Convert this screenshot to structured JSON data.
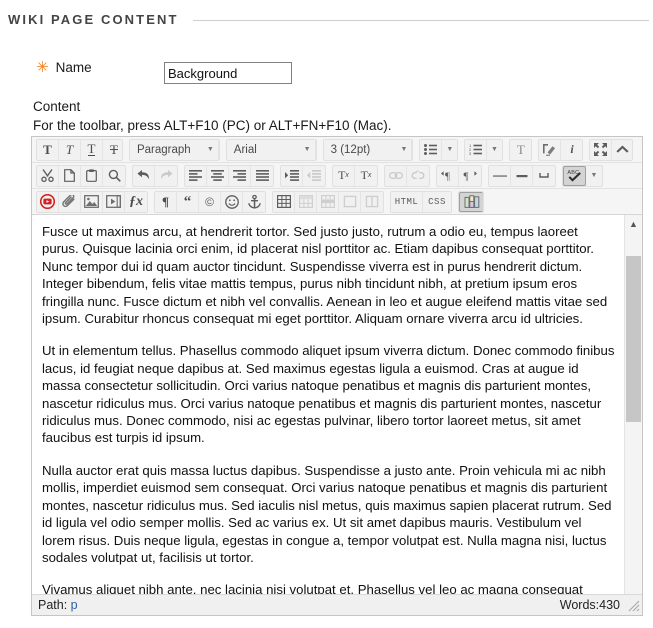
{
  "section": {
    "title": "Wiki Page Content"
  },
  "form": {
    "required_marker": "✳",
    "name_label": "Name",
    "name_value": "Background",
    "name_placeholder": "",
    "content_label": "Content",
    "toolbar_hint": "For the toolbar, press ALT+F10 (PC) or ALT+FN+F10 (Mac)."
  },
  "editor": {
    "toolbar": {
      "row1": {
        "format_buttons": [
          {
            "name": "bold-button",
            "label": "T"
          },
          {
            "name": "italic-button",
            "label": "T"
          },
          {
            "name": "underline-button",
            "label": "T"
          },
          {
            "name": "strikethrough-button",
            "label": "T"
          }
        ],
        "block_format": {
          "name": "paragraph-format-select",
          "value": "Paragraph"
        },
        "font_family": {
          "name": "font-family-select",
          "value": "Arial"
        },
        "font_size": {
          "name": "font-size-select",
          "value": "3 (12pt)"
        },
        "bullet_list": {
          "name": "bullet-list-button"
        },
        "numbered_list": {
          "name": "numbered-list-button"
        },
        "text_color": {
          "name": "text-color-button",
          "label": "T"
        },
        "background_color": {
          "name": "background-color-button"
        },
        "more_info": {
          "name": "info-button",
          "label": "i"
        },
        "fullscreen": {
          "name": "fullscreen-button"
        },
        "collapse": {
          "name": "collapse-toolbar-button"
        }
      },
      "row2": {
        "cut": {
          "name": "cut-button"
        },
        "copy": {
          "name": "copy-button"
        },
        "paste": {
          "name": "paste-button"
        },
        "find": {
          "name": "find-replace-button"
        },
        "undo": {
          "name": "undo-button"
        },
        "redo": {
          "name": "redo-button"
        },
        "align_left": {
          "name": "align-left-button"
        },
        "align_center": {
          "name": "align-center-button"
        },
        "align_right": {
          "name": "align-right-button"
        },
        "align_justify": {
          "name": "align-justify-button"
        },
        "indent": {
          "name": "indent-button"
        },
        "outdent": {
          "name": "outdent-button"
        },
        "superscript": {
          "name": "superscript-button",
          "label": "T"
        },
        "subscript": {
          "name": "subscript-button",
          "label": "T"
        },
        "link": {
          "name": "insert-link-button"
        },
        "unlink": {
          "name": "unlink-button"
        },
        "ltr": {
          "name": "text-direction-ltr-button"
        },
        "rtl": {
          "name": "text-direction-rtl-button"
        },
        "horizontal_rule": {
          "name": "horizontal-rule-button"
        },
        "em_dash": {
          "name": "em-dash-button"
        },
        "nbsp": {
          "name": "non-breaking-space-button"
        },
        "spellcheck": {
          "name": "spellcheck-button",
          "label": "ABC",
          "state": "active"
        },
        "spellcheck_menu": {
          "name": "spellcheck-menu-caret"
        }
      },
      "row3": {
        "youtube": {
          "name": "youtube-video-button"
        },
        "attachment": {
          "name": "attachment-button"
        },
        "image": {
          "name": "insert-image-button"
        },
        "media": {
          "name": "insert-media-button"
        },
        "formula": {
          "name": "insert-formula-button",
          "label": "ƒx"
        },
        "pilcrow": {
          "name": "show-invisible-characters-button",
          "label": "¶"
        },
        "blockquote": {
          "name": "blockquote-button",
          "label": "“"
        },
        "copyright": {
          "name": "insert-special-character-button",
          "label": "©"
        },
        "emoji": {
          "name": "emoticon-button"
        },
        "anchor": {
          "name": "insert-anchor-button"
        },
        "insert_table": {
          "name": "insert-table-button"
        },
        "table_properties": {
          "name": "table-properties-button"
        },
        "table_row": {
          "name": "table-row-properties-button"
        },
        "table_cell": {
          "name": "table-cell-properties-button"
        },
        "table_columns": {
          "name": "table-column-properties-button"
        },
        "html_source": {
          "name": "edit-html-source-button",
          "label": "HTML"
        },
        "css_source": {
          "name": "edit-css-button",
          "label": "CSS"
        },
        "templates": {
          "name": "templates-button"
        }
      }
    },
    "body": {
      "paragraphs": [
        "Fusce ut maximus arcu, at hendrerit tortor. Sed justo justo, rutrum a odio eu, tempus laoreet purus. Quisque lacinia orci enim, id placerat nisl porttitor ac. Etiam dapibus consequat porttitor. Nunc tempor dui id quam auctor tincidunt. Suspendisse viverra est in purus hendrerit dictum. Integer bibendum, felis vitae mattis tempus, purus nibh tincidunt nibh, at pretium ipsum eros fringilla nunc. Fusce dictum et nibh vel convallis. Aenean in leo et augue eleifend mattis vitae sed ipsum. Curabitur rhoncus consequat mi eget porttitor. Aliquam ornare viverra arcu id ultricies.",
        "Ut in elementum tellus. Phasellus commodo aliquet ipsum viverra dictum. Donec commodo finibus lacus, id feugiat neque dapibus at. Sed maximus egestas ligula a euismod. Cras at augue id massa consectetur sollicitudin. Orci varius natoque penatibus et magnis dis parturient montes, nascetur ridiculus mus. Orci varius natoque penatibus et magnis dis parturient montes, nascetur ridiculus mus. Donec commodo, nisi ac egestas pulvinar, libero tortor laoreet metus, sit amet faucibus est turpis id ipsum.",
        "Nulla auctor erat quis massa luctus dapibus. Suspendisse a justo ante. Proin vehicula mi ac nibh mollis, imperdiet euismod sem consequat. Orci varius natoque penatibus et magnis dis parturient montes, nascetur ridiculus mus. Sed iaculis nisl metus, quis maximus sapien placerat rutrum. Sed id ligula vel odio semper mollis. Sed ac varius ex. Ut sit amet dapibus mauris. Vestibulum vel lorem risus. Duis neque ligula, egestas in congue a, tempor volutpat est. Nulla magna nisi, luctus sodales volutpat ut, facilisis ut tortor.",
        "Vivamus aliquet nibh ante, nec lacinia nisi volutpat et. Phasellus vel leo ac magna consequat suscipit in a nulla. Suspendisse eleifend bibendum odio, ac aliquam risus mollis sit amet. Morbi ac purus sagittis, congue velit dapibus, suscipit lectus. Etiam suscipit, purus vitae laoreet dictum, nisl"
      ]
    },
    "status": {
      "path_label": "Path:",
      "path_value": "p",
      "word_count": "Words:430",
      "resize_handle": "resize-grip-icon"
    },
    "scrollbar": {
      "up_arrow": "scroll-up-arrow-icon",
      "down_arrow": "scroll-down-arrow-icon",
      "thumb": "scrollbar-thumb"
    }
  },
  "colors": {
    "accent_required": "#f07c1c",
    "header_text": "#444444",
    "path_value": "#2a5fa5",
    "youtube_red": "#d32020"
  }
}
